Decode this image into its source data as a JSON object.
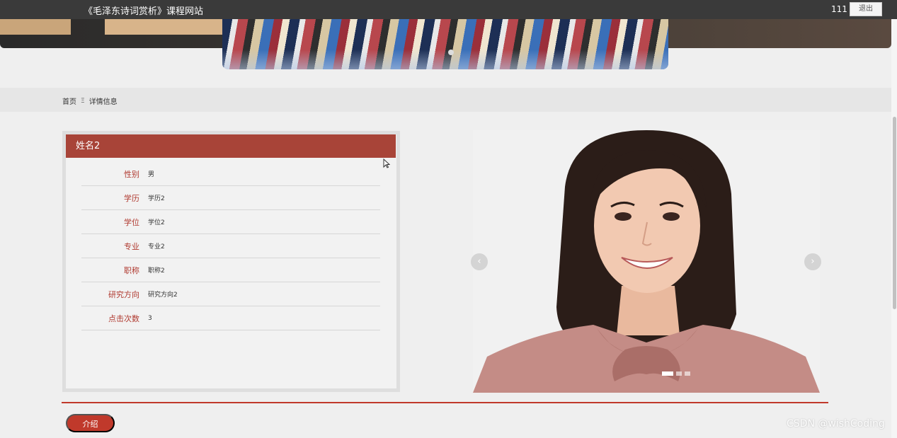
{
  "header": {
    "site_title": "《毛泽东诗词赏析》课程网站",
    "username": "111",
    "logout_label": "退出"
  },
  "breadcrumb": {
    "home": "首页",
    "separator": "Ξ",
    "current": "详情信息"
  },
  "detail": {
    "name": "姓名2",
    "fields": [
      {
        "label": "性别",
        "value": "男"
      },
      {
        "label": "学历",
        "value": "学历2"
      },
      {
        "label": "学位",
        "value": "学位2"
      },
      {
        "label": "专业",
        "value": "专业2"
      },
      {
        "label": "职称",
        "value": "职称2"
      },
      {
        "label": "研究方向",
        "value": "研究方向2"
      },
      {
        "label": "点击次数",
        "value": "3"
      }
    ]
  },
  "carousel": {
    "prev_label": "‹",
    "next_label": "›",
    "slide_count": 3,
    "active_slide": 1
  },
  "tabs": {
    "intro_label": "介绍"
  },
  "watermark": "CSDN @wishCoding",
  "colors": {
    "accent": "#a84438",
    "tab_red": "#c0392b",
    "topbar": "#3a3a3a"
  }
}
